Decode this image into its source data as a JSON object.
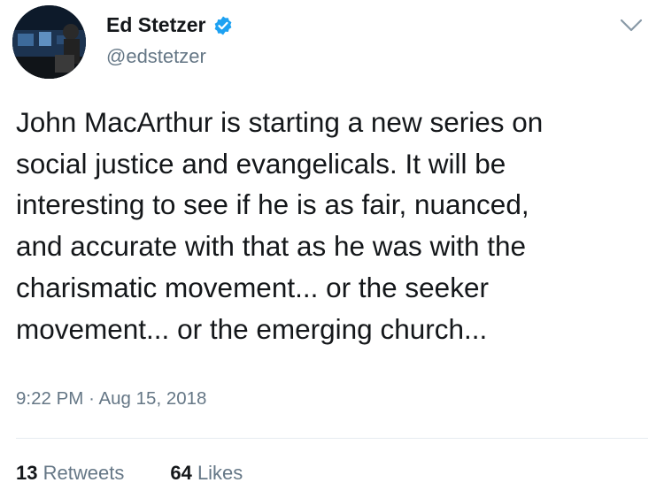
{
  "author": {
    "display_name": "Ed Stetzer",
    "handle": "@edstetzer",
    "verified": true
  },
  "tweet": {
    "text": "John MacArthur is starting a new series on\nsocial justice and evangelicals. It will be\ninteresting to see if he is as fair, nuanced,\nand accurate with that as he was with the\ncharismatic movement... or the seeker\nmovement... or the emerging church...",
    "time": "9:22 PM",
    "separator": "·",
    "date": "Aug 15, 2018"
  },
  "stats": {
    "retweets_count": "13",
    "retweets_label": "Retweets",
    "likes_count": "64",
    "likes_label": "Likes"
  },
  "icons": {
    "verified": "verified-badge-icon",
    "menu": "chevron-down-icon"
  },
  "colors": {
    "text": "#14171a",
    "secondary": "#657786",
    "verified_blue": "#1da1f2",
    "divider": "#e6ecf0"
  }
}
